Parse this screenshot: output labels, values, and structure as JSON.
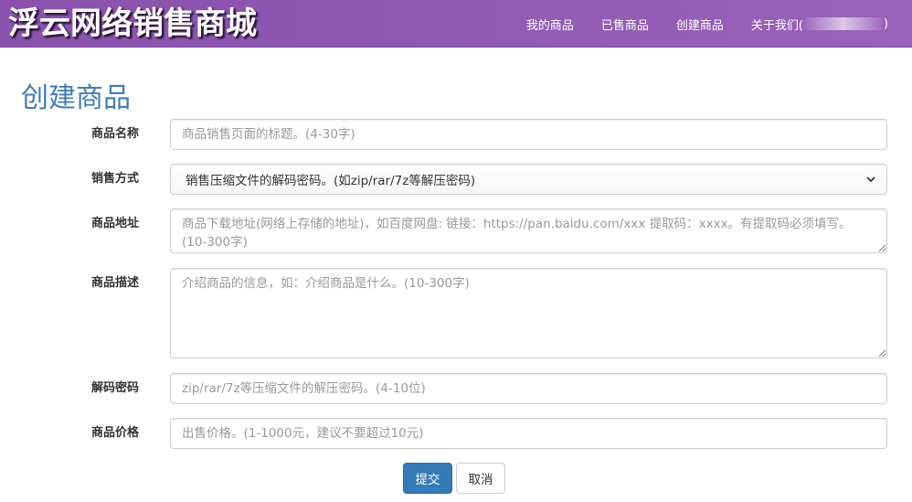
{
  "header": {
    "brand": "浮云网络销售商城",
    "nav": [
      {
        "label": "我的商品"
      },
      {
        "label": "已售商品"
      },
      {
        "label": "创建商品"
      }
    ],
    "about": {
      "prefix": "关于我们(",
      "suffix": ")"
    }
  },
  "form": {
    "title": "创建商品",
    "name": {
      "label": "商品名称",
      "placeholder": "商品销售页面的标题。(4-30字)"
    },
    "sale_method": {
      "label": "销售方式",
      "value": "销售压缩文件的解码密码。(如zip/rar/7z等解压密码)"
    },
    "address": {
      "label": "商品地址",
      "placeholder": "商品下载地址(网络上存储的地址)，如百度网盘: 链接：https://pan.baidu.com/xxx 提取码：xxxx。有提取码必须填写。(10-300字)"
    },
    "description": {
      "label": "商品描述",
      "placeholder": "介绍商品的信息，如：介绍商品是什么。(10-300字)"
    },
    "password": {
      "label": "解码密码",
      "placeholder": "zip/rar/7z等压缩文件的解压密码。(4-10位)"
    },
    "price": {
      "label": "商品价格",
      "placeholder": "出售价格。(1-1000元，建议不要超过10元)"
    },
    "submit_label": "提交",
    "cancel_label": "取消"
  },
  "colors": {
    "navbar": "#8f5ab3",
    "title": "#3f7cb6",
    "primary": "#337ab7"
  }
}
